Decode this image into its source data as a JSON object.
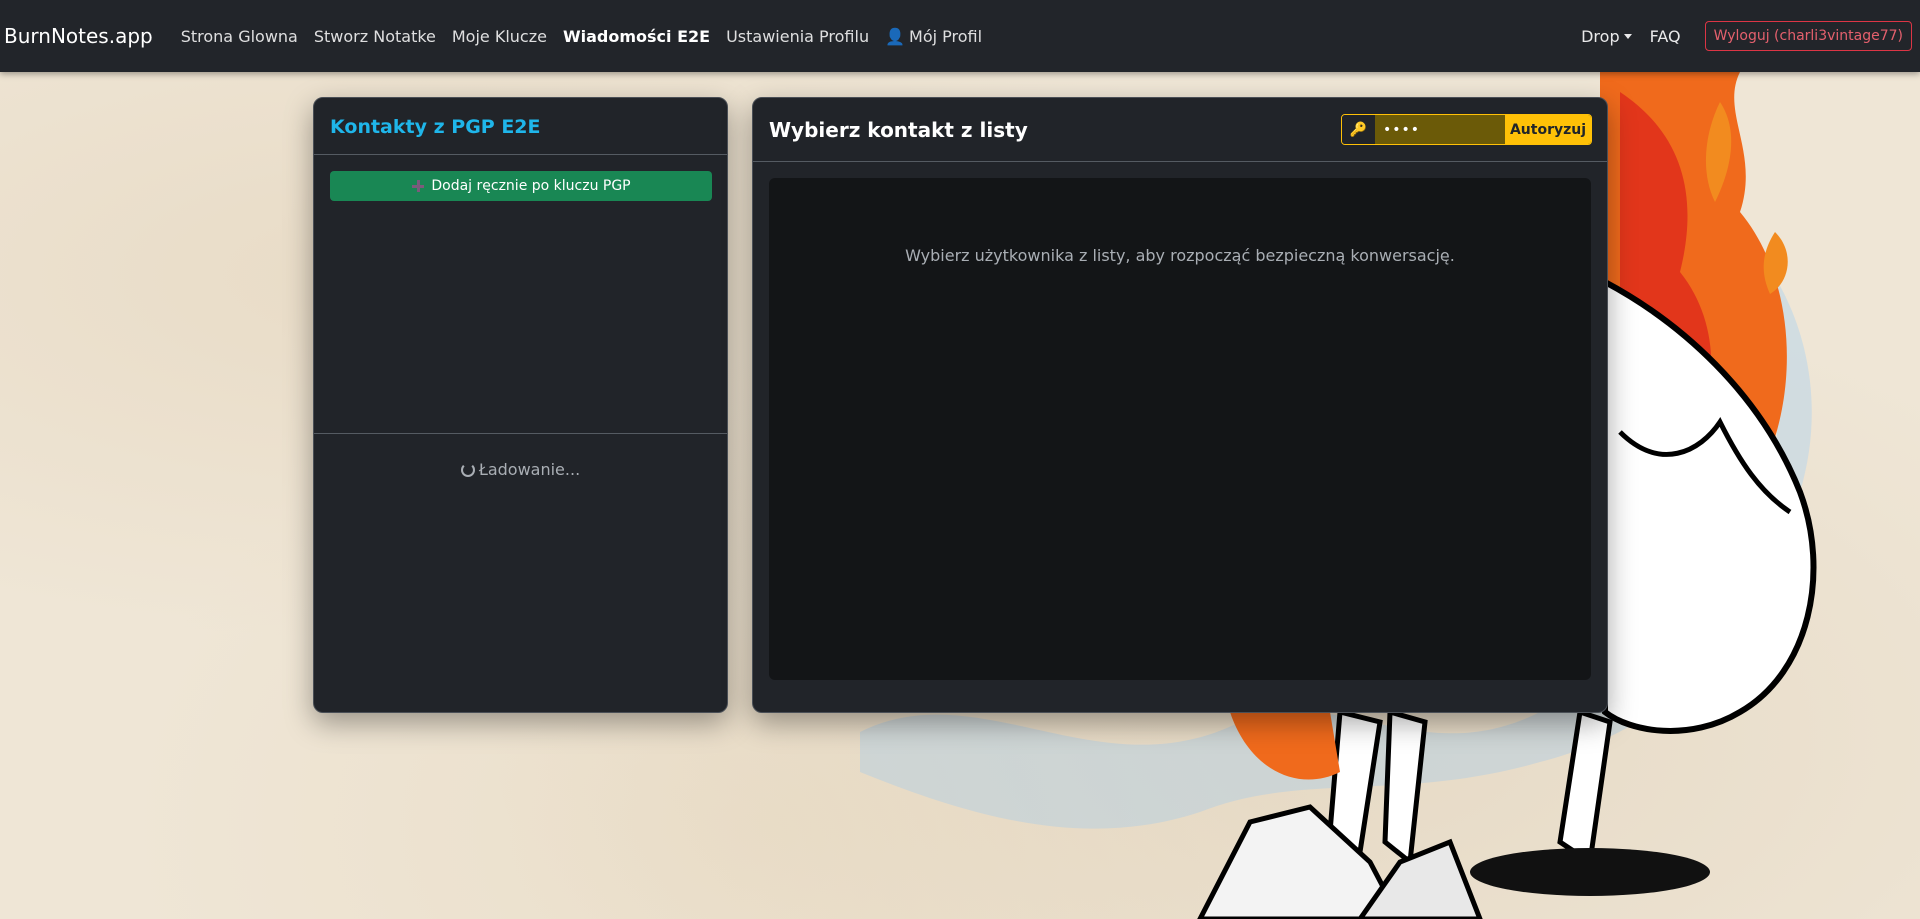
{
  "navbar": {
    "brand": "BurnNotes.app",
    "links": [
      {
        "label": "Strona Glowna"
      },
      {
        "label": "Stworz Notatke"
      },
      {
        "label": "Moje Klucze"
      },
      {
        "label": "Wiadomości E2E"
      },
      {
        "label": "Ustawienia Profilu"
      },
      {
        "label": "Mój Profil"
      }
    ],
    "drop_label": "Drop",
    "faq_label": "FAQ",
    "logout_label": "Wyloguj (charli3vintage77)"
  },
  "contacts": {
    "title": "Kontakty z PGP E2E",
    "add_button": "Dodaj ręcznie po kluczu PGP",
    "loading_text": "Ładowanie..."
  },
  "chat": {
    "title": "Wybierz kontakt z listy",
    "password_value": "••••",
    "authorize_button": "Autoryzuj",
    "placeholder": "Wybierz użytkownika z listy, aby rozpocząć bezpieczną konwersację."
  },
  "colors": {
    "navbar_bg": "#22252a",
    "card_bg": "#212429",
    "accent_cyan": "#1fb6ea",
    "success_green": "#198754",
    "warning_yellow": "#ffc107",
    "danger_red": "#dc3545"
  },
  "icons": {
    "profile": "person-icon",
    "add": "plus-icon",
    "loading": "spinner-icon",
    "auth": "key-icon",
    "drop": "caret-down-icon"
  }
}
